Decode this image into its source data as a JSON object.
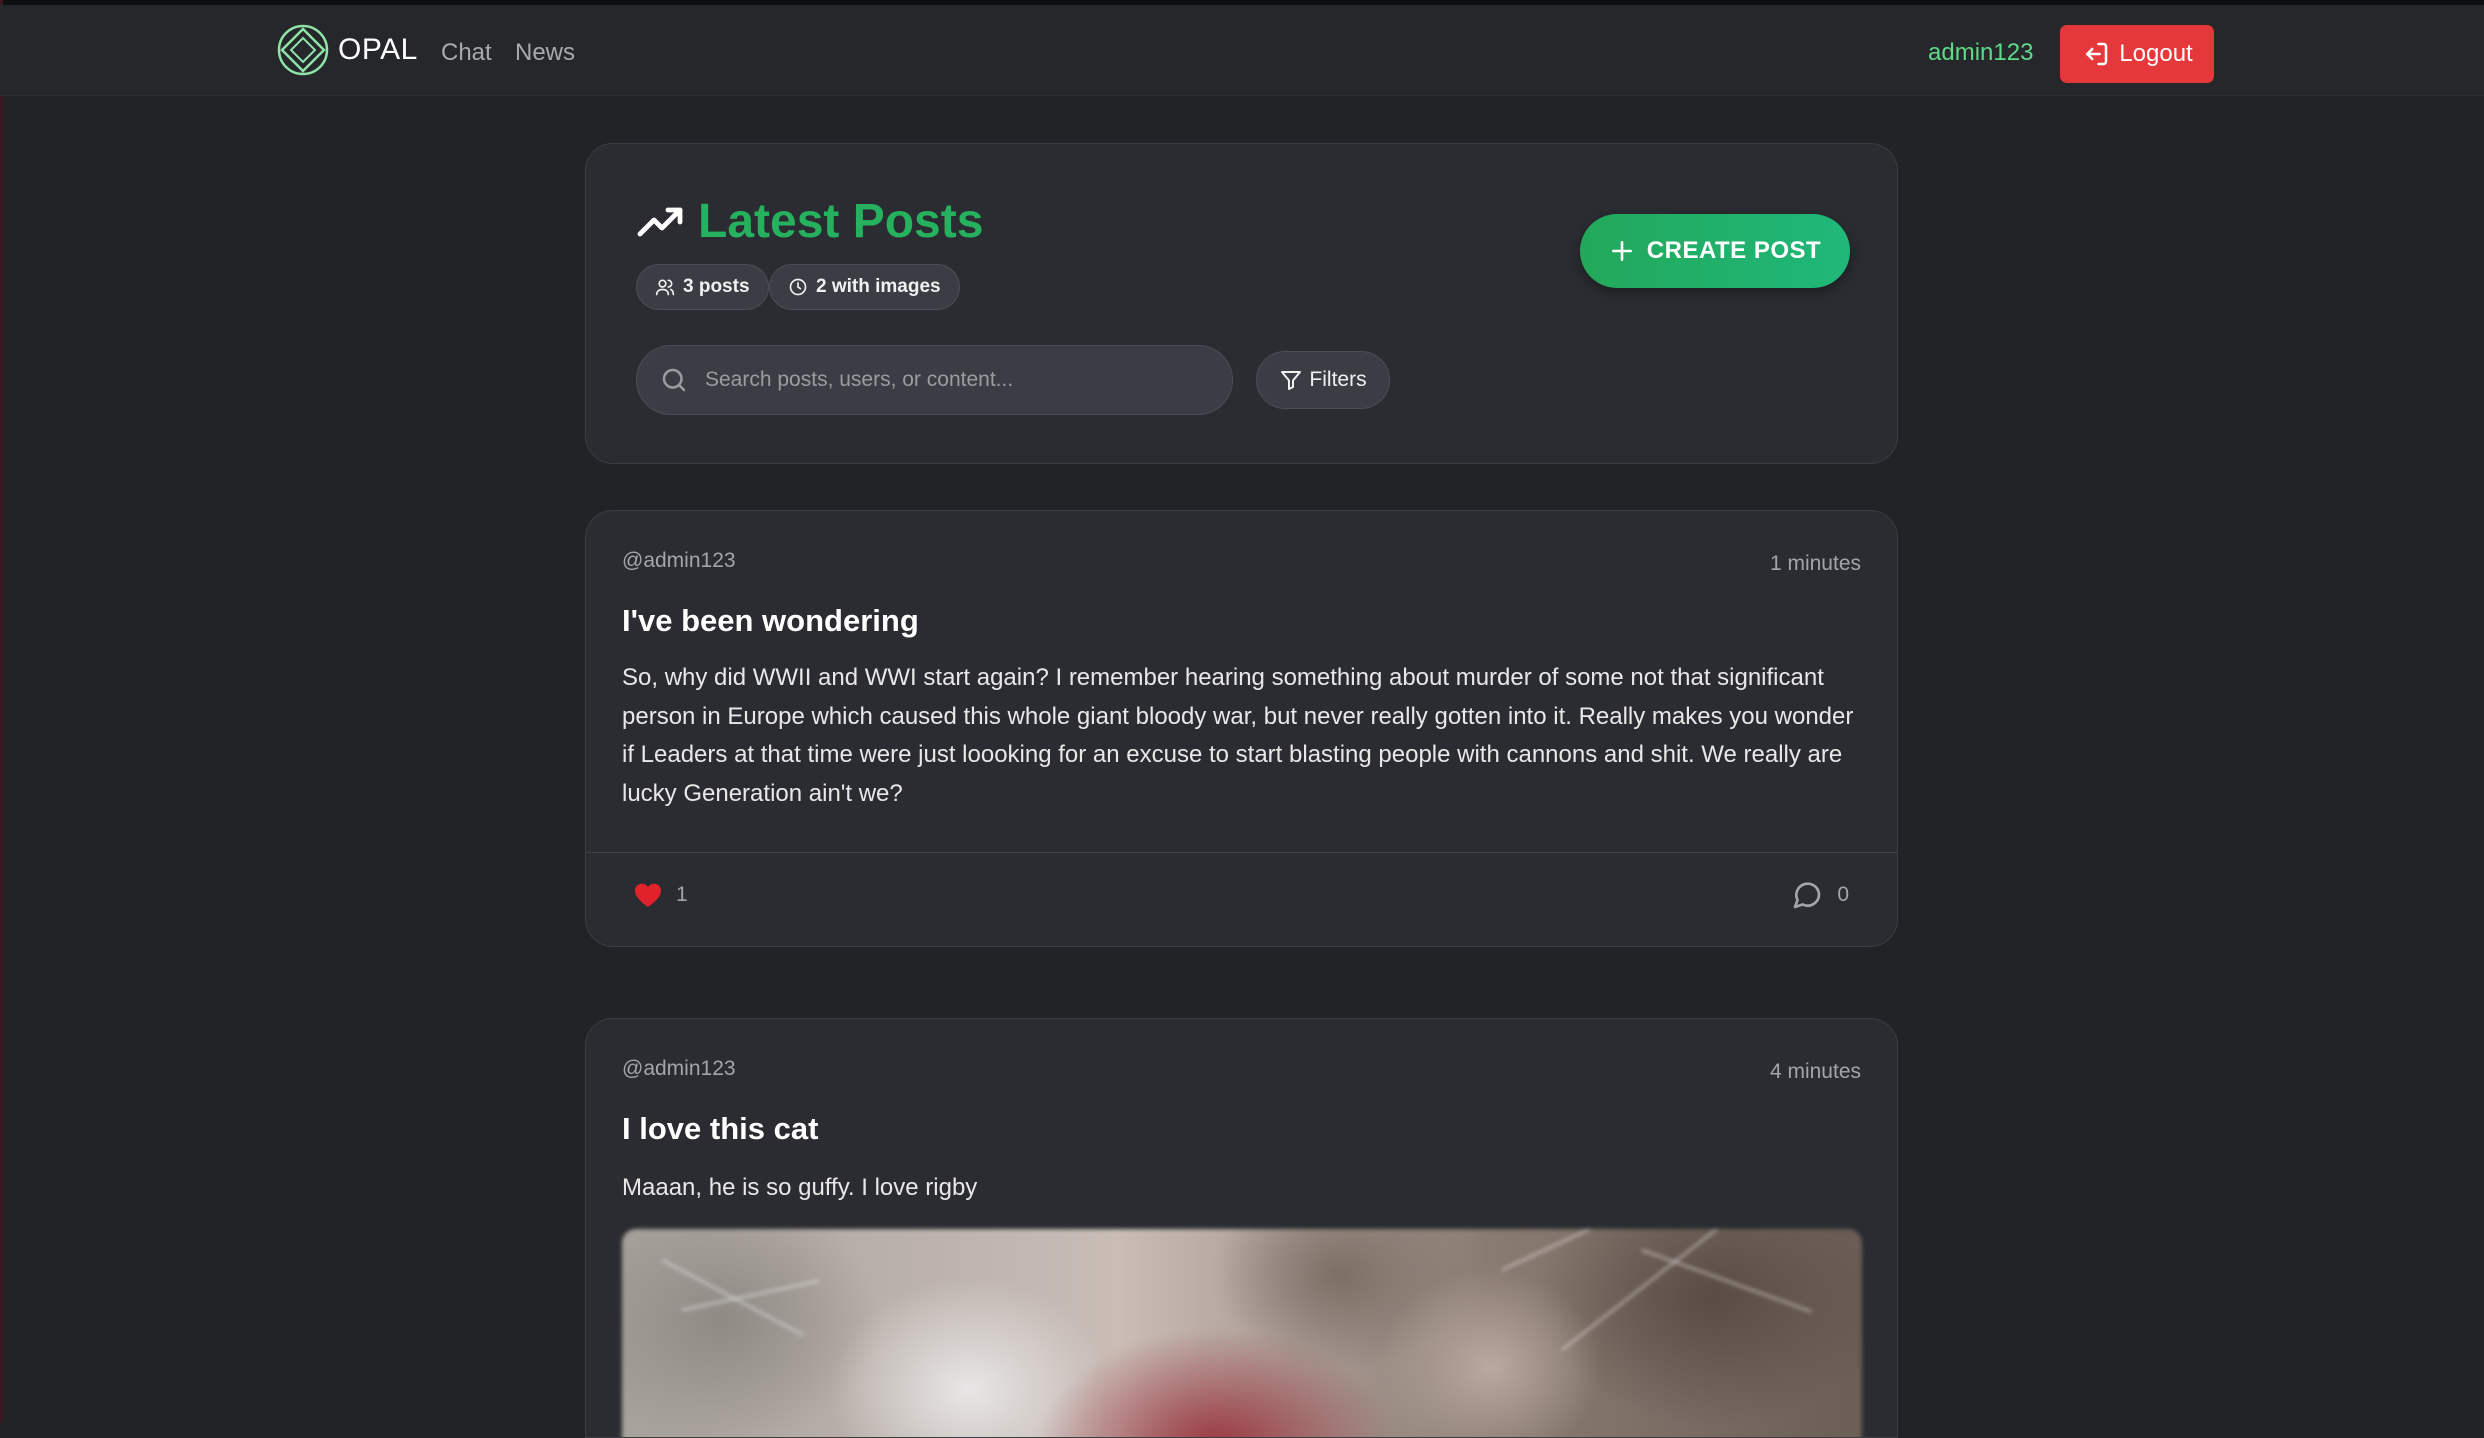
{
  "nav": {
    "brand": "OPAL",
    "links": [
      "Chat",
      "News"
    ],
    "username": "admin123",
    "logout_label": "Logout"
  },
  "header": {
    "title": "Latest Posts",
    "stats": {
      "posts": "3 posts",
      "images": "2 with images"
    },
    "create_label": "CREATE POST",
    "search_placeholder": "Search posts, users, or content...",
    "filters_label": "Filters"
  },
  "posts": [
    {
      "author": "@admin123",
      "time": "1 minutes",
      "title": "I've been wondering",
      "body": "So, why did WWII and WWI start again? I remember hearing something about murder of some not that significant person in Europe which caused this whole giant bloody war, but never really gotten into it. Really makes you wonder if Leaders at that time were just loooking for an excuse to start blasting people with cannons and shit. We really are lucky Generation ain't we?",
      "likes": "1",
      "comments": "0"
    },
    {
      "author": "@admin123",
      "time": "4 minutes",
      "title": "I love this cat",
      "body": "Maaan, he is so guffy. I love rigby"
    }
  ],
  "colors": {
    "accent_green": "#26b15e",
    "logout_red": "#e5383b",
    "username_green": "#5fd98a",
    "like_red": "#e0232b"
  }
}
